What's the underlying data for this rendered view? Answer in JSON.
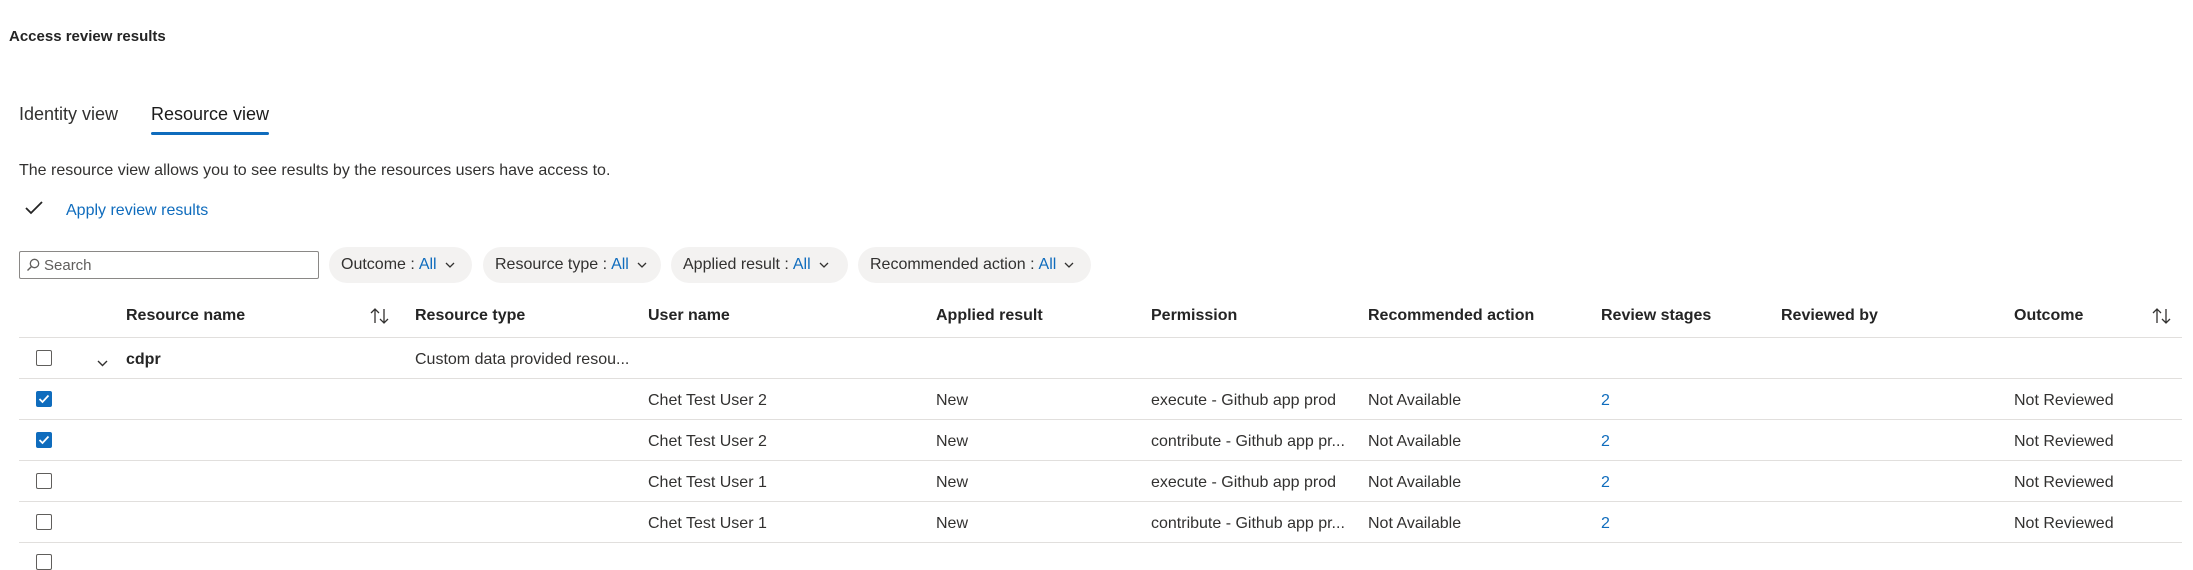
{
  "page": {
    "title": "Access review results"
  },
  "tabs": [
    {
      "label": "Identity view",
      "active": false
    },
    {
      "label": "Resource view",
      "active": true
    }
  ],
  "description": "The resource view allows you to see results by the resources users have access to.",
  "toolbar": {
    "apply_label": "Apply review results",
    "apply_icon": "checkmark-icon"
  },
  "search": {
    "placeholder": "Search",
    "icon": "search-icon"
  },
  "filters": [
    {
      "label": "Outcome :",
      "value": "All"
    },
    {
      "label": "Resource type :",
      "value": "All"
    },
    {
      "label": "Applied result :",
      "value": "All"
    },
    {
      "label": "Recommended action :",
      "value": "All"
    }
  ],
  "table": {
    "columns": [
      "Resource name",
      "Resource type",
      "User name",
      "Applied result",
      "Permission",
      "Recommended action",
      "Review stages",
      "Reviewed by",
      "Outcome"
    ],
    "group": {
      "name": "cdpr",
      "type": "Custom data provided resou..."
    },
    "rows": [
      {
        "checked": true,
        "user": "Chet Test User 2",
        "applied": "New",
        "permission": "execute - Github app prod",
        "recommended": "Not Available",
        "stages": "2",
        "reviewed_by": "",
        "outcome": "Not Reviewed"
      },
      {
        "checked": true,
        "user": "Chet Test User 2",
        "applied": "New",
        "permission": "contribute - Github app pr...",
        "recommended": "Not Available",
        "stages": "2",
        "reviewed_by": "",
        "outcome": "Not Reviewed"
      },
      {
        "checked": false,
        "user": "Chet Test User 1",
        "applied": "New",
        "permission": "execute - Github app prod",
        "recommended": "Not Available",
        "stages": "2",
        "reviewed_by": "",
        "outcome": "Not Reviewed"
      },
      {
        "checked": false,
        "user": "Chet Test User 1",
        "applied": "New",
        "permission": "contribute - Github app pr...",
        "recommended": "Not Available",
        "stages": "2",
        "reviewed_by": "",
        "outcome": "Not Reviewed"
      }
    ]
  },
  "colors": {
    "accent": "#0f6cbd",
    "divider": "#e1dfdd",
    "pill_bg": "#f3f2f1"
  }
}
